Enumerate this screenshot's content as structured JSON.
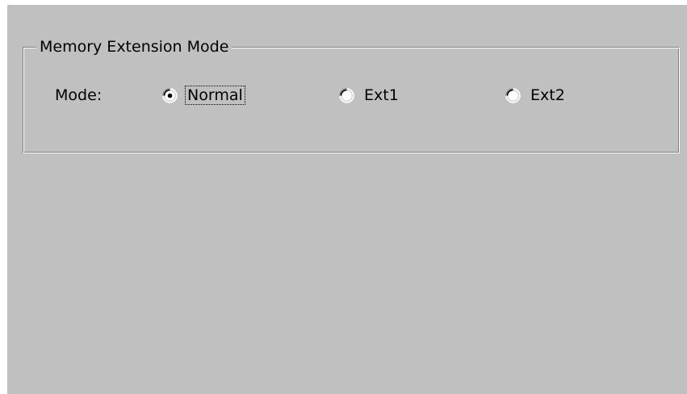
{
  "group": {
    "title": "Memory Extension Mode"
  },
  "mode": {
    "label": "Mode:",
    "selected": "Normal",
    "options": [
      {
        "label": "Normal",
        "checked": true,
        "focused": true
      },
      {
        "label": "Ext1",
        "checked": false,
        "focused": false
      },
      {
        "label": "Ext2",
        "checked": false,
        "focused": false
      }
    ]
  },
  "colors": {
    "face": "#c0c0c0",
    "highlight": "#ffffff",
    "shadow": "#808080",
    "dark_shadow": "#000000"
  }
}
